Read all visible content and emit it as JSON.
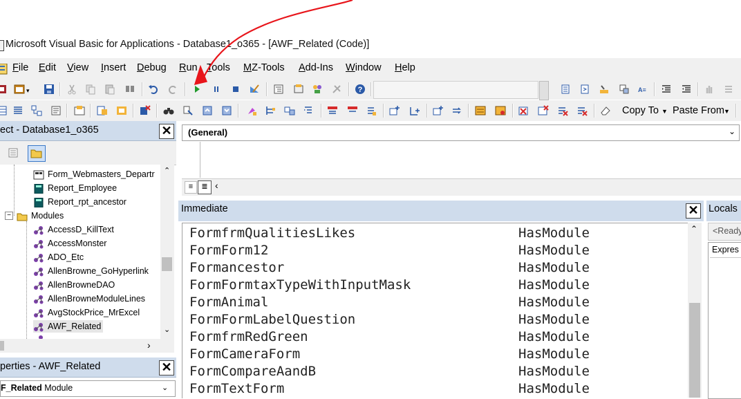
{
  "window": {
    "title": "Microsoft Visual Basic for Applications - Database1_o365 - [AWF_Related (Code)]"
  },
  "menu": [
    "File",
    "Edit",
    "View",
    "Insert",
    "Debug",
    "Run",
    "Tools",
    "MZ-Tools",
    "Add-Ins",
    "Window",
    "Help"
  ],
  "toolbar2": {
    "copy_to": "Copy To",
    "paste_from": "Paste From"
  },
  "project": {
    "title": "ect - Database1_o365",
    "items": [
      {
        "label": "Form_Webmasters_Departr",
        "icon": "form-icon"
      },
      {
        "label": "Report_Employee",
        "icon": "report-icon"
      },
      {
        "label": "Report_rpt_ancestor",
        "icon": "report-icon"
      },
      {
        "label": "Modules",
        "icon": "folder-icon"
      },
      {
        "label": "AccessD_KillText",
        "icon": "module-icon"
      },
      {
        "label": "AccessMonster",
        "icon": "module-icon"
      },
      {
        "label": "ADO_Etc",
        "icon": "module-icon"
      },
      {
        "label": "AllenBrowne_GoHyperlink",
        "icon": "module-icon"
      },
      {
        "label": "AllenBrowneDAO",
        "icon": "module-icon"
      },
      {
        "label": "AllenBrowneModuleLines",
        "icon": "module-icon"
      },
      {
        "label": "AvgStockPrice_MrExcel",
        "icon": "module-icon"
      },
      {
        "label": "AWF_Related",
        "icon": "module-icon"
      }
    ]
  },
  "properties": {
    "title": "perties - AWF_Related",
    "object_name": "F_Related",
    "object_type": "Module"
  },
  "code": {
    "object_combo": "(General)"
  },
  "immediate": {
    "title": "Immediate",
    "rows": [
      {
        "name": "FormfrmQualitiesLikes",
        "status": "HasModule"
      },
      {
        "name": "FormForm12",
        "status": "HasModule"
      },
      {
        "name": "Formancestor",
        "status": "HasModule"
      },
      {
        "name": "FormFormtaxTypeWithInputMask",
        "status": "HasModule"
      },
      {
        "name": "FormAnimal",
        "status": "HasModule"
      },
      {
        "name": "FormFormLabelQuestion",
        "status": "HasModule"
      },
      {
        "name": "FormfrmRedGreen",
        "status": "HasModule"
      },
      {
        "name": "FormCameraForm",
        "status": "HasModule"
      },
      {
        "name": "FormCompareAandB",
        "status": "HasModule"
      },
      {
        "name": "FormTextForm",
        "status": "HasModule"
      }
    ]
  },
  "locals": {
    "title": "Locals",
    "status": "<Ready",
    "column": "Expres"
  },
  "colors": {
    "panel_header": "#cfdcec",
    "toolbar_bg": "#f0f0f0",
    "annotation_arrow": "#e8151b"
  }
}
